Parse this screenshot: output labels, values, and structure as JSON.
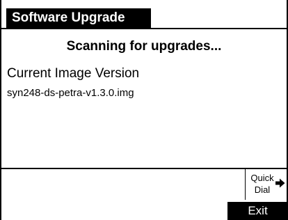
{
  "header": {
    "title": "Software Upgrade"
  },
  "main": {
    "status": "Scanning for upgrades...",
    "version_label": "Current Image Version",
    "version_value": "syn248-ds-petra-v1.3.0.img"
  },
  "softkeys": {
    "quick_dial_line1": "Quick",
    "quick_dial_line2": "Dial",
    "quick_dial_icon": "right-arrow-icon",
    "exit_label": "Exit"
  },
  "colors": {
    "background": "#ffffff",
    "foreground": "#000000",
    "inverse_text": "#ffffff"
  }
}
